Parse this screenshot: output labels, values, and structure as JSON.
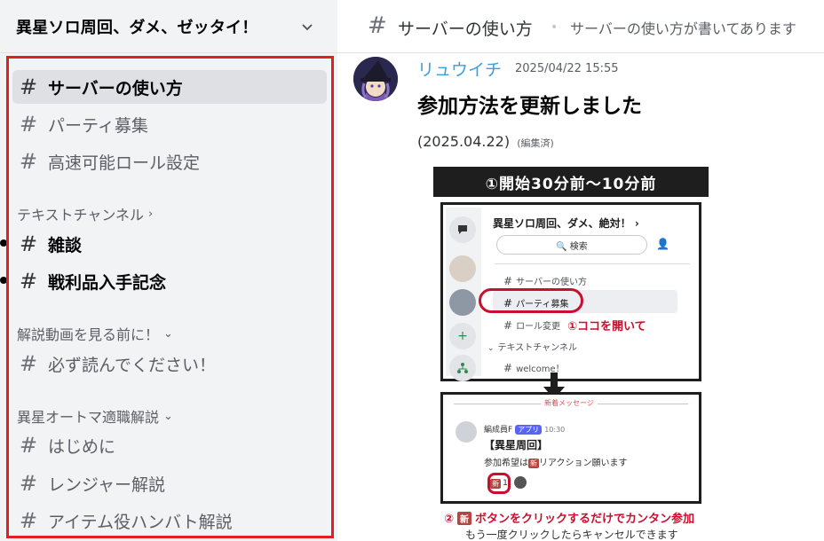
{
  "server": {
    "name": "異星ソロ周回、ダメ、ゼッタイ！"
  },
  "sidebar": {
    "channels_top": [
      {
        "name": "サーバーの使い方",
        "active": true
      },
      {
        "name": "パーティ募集"
      },
      {
        "name": "高速可能ロール設定"
      }
    ],
    "categories": [
      {
        "label": "テキストチャンネル",
        "chevron": "›",
        "channels": [
          {
            "name": "雑談",
            "unread": true
          },
          {
            "name": "戦利品入手記念",
            "unread": true
          }
        ]
      },
      {
        "label": "解説動画を見る前に！",
        "chevron": "⌄",
        "channels": [
          {
            "name": "必ず読んでください！"
          }
        ]
      },
      {
        "label": "異星オートマ適職解説",
        "chevron": "⌄",
        "channels": [
          {
            "name": "はじめに"
          },
          {
            "name": "レンジャー解説"
          },
          {
            "name": "アイテム役ハンバト解説"
          }
        ]
      }
    ]
  },
  "topbar": {
    "hash": "#",
    "channel": "サーバーの使い方",
    "separator": "•",
    "topic": "サーバーの使い方が書いてあります"
  },
  "message": {
    "author": "リュウイチ",
    "timestamp": "2025/04/22 15:55",
    "heading": "参加方法を更新しました",
    "date": "(2025.04.22)",
    "edited": "(編集済)"
  },
  "embed_image": {
    "step1_banner": "①開始30分前〜10分前",
    "mini_server_title": "異星ソロ周回、ダメ、絶対！ ›",
    "mini_search": "🔍 検索",
    "mini_channels": [
      "サーバーの使い方",
      "パーティ募集",
      "ロール変更"
    ],
    "mini_category": "テキストチャンネル",
    "mini_channel_welcome": "welcome！",
    "note1": "①ココを開いて",
    "new_messages": "新着メッセージ",
    "bot_name": "編成員F",
    "bot_tag": "アプリ",
    "bot_time": "10:30",
    "bot_title": "【異星周回】",
    "bot_text_before": "参加希望は",
    "bot_badge": "新",
    "bot_text_after": "リアクション願います",
    "reaction_count": "1",
    "step2_num": "②",
    "step2_badge": "新",
    "step2_text": "ボタンをクリックするだけでカンタン参加",
    "cancel_note": "もう一度クリックしたらキャンセルできます"
  },
  "colors": {
    "highlight_border": "#e02020",
    "author": "#3aa0d8",
    "annotation_red": "#c8102e"
  }
}
